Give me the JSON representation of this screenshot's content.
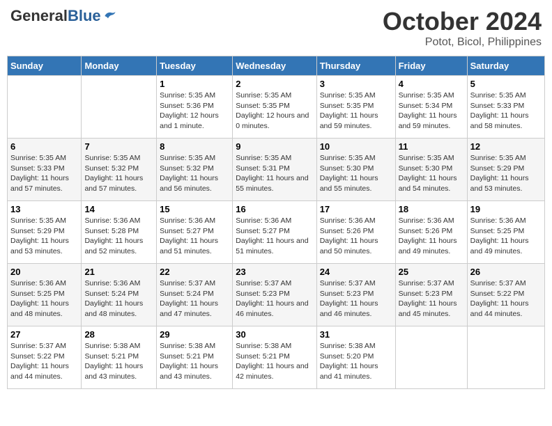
{
  "logo": {
    "general": "General",
    "blue": "Blue"
  },
  "title": "October 2024",
  "location": "Potot, Bicol, Philippines",
  "headers": [
    "Sunday",
    "Monday",
    "Tuesday",
    "Wednesday",
    "Thursday",
    "Friday",
    "Saturday"
  ],
  "weeks": [
    [
      {
        "day": "",
        "sunrise": "",
        "sunset": "",
        "daylight": ""
      },
      {
        "day": "",
        "sunrise": "",
        "sunset": "",
        "daylight": ""
      },
      {
        "day": "1",
        "sunrise": "Sunrise: 5:35 AM",
        "sunset": "Sunset: 5:36 PM",
        "daylight": "Daylight: 12 hours and 1 minute."
      },
      {
        "day": "2",
        "sunrise": "Sunrise: 5:35 AM",
        "sunset": "Sunset: 5:35 PM",
        "daylight": "Daylight: 12 hours and 0 minutes."
      },
      {
        "day": "3",
        "sunrise": "Sunrise: 5:35 AM",
        "sunset": "Sunset: 5:35 PM",
        "daylight": "Daylight: 11 hours and 59 minutes."
      },
      {
        "day": "4",
        "sunrise": "Sunrise: 5:35 AM",
        "sunset": "Sunset: 5:34 PM",
        "daylight": "Daylight: 11 hours and 59 minutes."
      },
      {
        "day": "5",
        "sunrise": "Sunrise: 5:35 AM",
        "sunset": "Sunset: 5:33 PM",
        "daylight": "Daylight: 11 hours and 58 minutes."
      }
    ],
    [
      {
        "day": "6",
        "sunrise": "Sunrise: 5:35 AM",
        "sunset": "Sunset: 5:33 PM",
        "daylight": "Daylight: 11 hours and 57 minutes."
      },
      {
        "day": "7",
        "sunrise": "Sunrise: 5:35 AM",
        "sunset": "Sunset: 5:32 PM",
        "daylight": "Daylight: 11 hours and 57 minutes."
      },
      {
        "day": "8",
        "sunrise": "Sunrise: 5:35 AM",
        "sunset": "Sunset: 5:32 PM",
        "daylight": "Daylight: 11 hours and 56 minutes."
      },
      {
        "day": "9",
        "sunrise": "Sunrise: 5:35 AM",
        "sunset": "Sunset: 5:31 PM",
        "daylight": "Daylight: 11 hours and 55 minutes."
      },
      {
        "day": "10",
        "sunrise": "Sunrise: 5:35 AM",
        "sunset": "Sunset: 5:30 PM",
        "daylight": "Daylight: 11 hours and 55 minutes."
      },
      {
        "day": "11",
        "sunrise": "Sunrise: 5:35 AM",
        "sunset": "Sunset: 5:30 PM",
        "daylight": "Daylight: 11 hours and 54 minutes."
      },
      {
        "day": "12",
        "sunrise": "Sunrise: 5:35 AM",
        "sunset": "Sunset: 5:29 PM",
        "daylight": "Daylight: 11 hours and 53 minutes."
      }
    ],
    [
      {
        "day": "13",
        "sunrise": "Sunrise: 5:35 AM",
        "sunset": "Sunset: 5:29 PM",
        "daylight": "Daylight: 11 hours and 53 minutes."
      },
      {
        "day": "14",
        "sunrise": "Sunrise: 5:36 AM",
        "sunset": "Sunset: 5:28 PM",
        "daylight": "Daylight: 11 hours and 52 minutes."
      },
      {
        "day": "15",
        "sunrise": "Sunrise: 5:36 AM",
        "sunset": "Sunset: 5:27 PM",
        "daylight": "Daylight: 11 hours and 51 minutes."
      },
      {
        "day": "16",
        "sunrise": "Sunrise: 5:36 AM",
        "sunset": "Sunset: 5:27 PM",
        "daylight": "Daylight: 11 hours and 51 minutes."
      },
      {
        "day": "17",
        "sunrise": "Sunrise: 5:36 AM",
        "sunset": "Sunset: 5:26 PM",
        "daylight": "Daylight: 11 hours and 50 minutes."
      },
      {
        "day": "18",
        "sunrise": "Sunrise: 5:36 AM",
        "sunset": "Sunset: 5:26 PM",
        "daylight": "Daylight: 11 hours and 49 minutes."
      },
      {
        "day": "19",
        "sunrise": "Sunrise: 5:36 AM",
        "sunset": "Sunset: 5:25 PM",
        "daylight": "Daylight: 11 hours and 49 minutes."
      }
    ],
    [
      {
        "day": "20",
        "sunrise": "Sunrise: 5:36 AM",
        "sunset": "Sunset: 5:25 PM",
        "daylight": "Daylight: 11 hours and 48 minutes."
      },
      {
        "day": "21",
        "sunrise": "Sunrise: 5:36 AM",
        "sunset": "Sunset: 5:24 PM",
        "daylight": "Daylight: 11 hours and 48 minutes."
      },
      {
        "day": "22",
        "sunrise": "Sunrise: 5:37 AM",
        "sunset": "Sunset: 5:24 PM",
        "daylight": "Daylight: 11 hours and 47 minutes."
      },
      {
        "day": "23",
        "sunrise": "Sunrise: 5:37 AM",
        "sunset": "Sunset: 5:23 PM",
        "daylight": "Daylight: 11 hours and 46 minutes."
      },
      {
        "day": "24",
        "sunrise": "Sunrise: 5:37 AM",
        "sunset": "Sunset: 5:23 PM",
        "daylight": "Daylight: 11 hours and 46 minutes."
      },
      {
        "day": "25",
        "sunrise": "Sunrise: 5:37 AM",
        "sunset": "Sunset: 5:23 PM",
        "daylight": "Daylight: 11 hours and 45 minutes."
      },
      {
        "day": "26",
        "sunrise": "Sunrise: 5:37 AM",
        "sunset": "Sunset: 5:22 PM",
        "daylight": "Daylight: 11 hours and 44 minutes."
      }
    ],
    [
      {
        "day": "27",
        "sunrise": "Sunrise: 5:37 AM",
        "sunset": "Sunset: 5:22 PM",
        "daylight": "Daylight: 11 hours and 44 minutes."
      },
      {
        "day": "28",
        "sunrise": "Sunrise: 5:38 AM",
        "sunset": "Sunset: 5:21 PM",
        "daylight": "Daylight: 11 hours and 43 minutes."
      },
      {
        "day": "29",
        "sunrise": "Sunrise: 5:38 AM",
        "sunset": "Sunset: 5:21 PM",
        "daylight": "Daylight: 11 hours and 43 minutes."
      },
      {
        "day": "30",
        "sunrise": "Sunrise: 5:38 AM",
        "sunset": "Sunset: 5:21 PM",
        "daylight": "Daylight: 11 hours and 42 minutes."
      },
      {
        "day": "31",
        "sunrise": "Sunrise: 5:38 AM",
        "sunset": "Sunset: 5:20 PM",
        "daylight": "Daylight: 11 hours and 41 minutes."
      },
      {
        "day": "",
        "sunrise": "",
        "sunset": "",
        "daylight": ""
      },
      {
        "day": "",
        "sunrise": "",
        "sunset": "",
        "daylight": ""
      }
    ]
  ]
}
